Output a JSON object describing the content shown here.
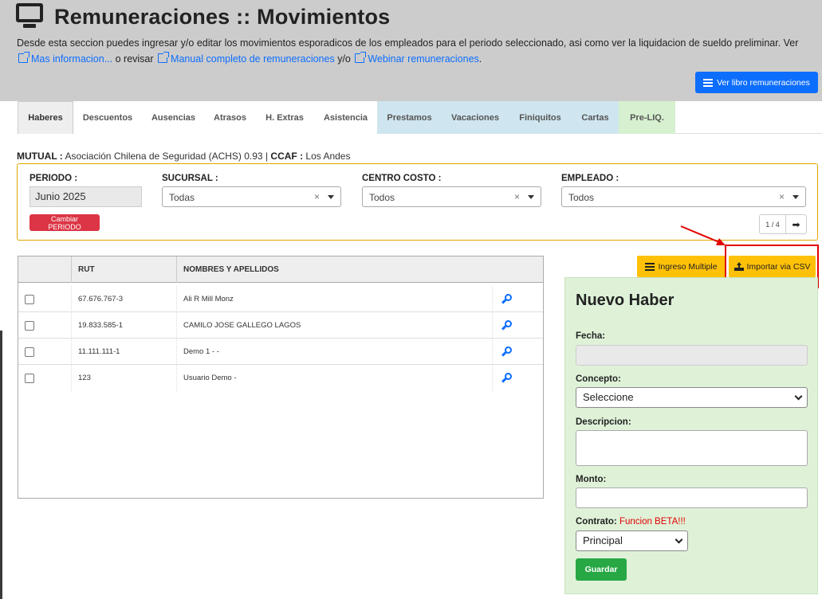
{
  "header": {
    "title": "Remuneraciones :: Movimientos",
    "desc_text_1": "Desde esta seccion puedes ingresar y/o editar los movimientos esporadicos de los empleados para el periodo seleccionado, asi como ver la liquidacion de sueldo preliminar. Ver",
    "link_mas_info": "Mas informacion...",
    "desc_text_2": "o revisar",
    "link_manual": "Manual completo de remuneraciones",
    "desc_text_3": "y/o",
    "link_webinar": "Webinar remuneraciones",
    "desc_text_4": ".",
    "btn_libro": "Ver libro remuneraciones"
  },
  "tabs": [
    {
      "label": "Haberes"
    },
    {
      "label": "Descuentos"
    },
    {
      "label": "Ausencias"
    },
    {
      "label": "Atrasos"
    },
    {
      "label": "H. Extras"
    },
    {
      "label": "Asistencia"
    },
    {
      "label": "Prestamos"
    },
    {
      "label": "Vacaciones"
    },
    {
      "label": "Finiquitos"
    },
    {
      "label": "Cartas"
    },
    {
      "label": "Pre-LIQ."
    }
  ],
  "info": {
    "mutual_label": "MUTUAL :",
    "mutual_value": "Asociación Chilena de Seguridad (ACHS) 0.93",
    "separator": "|",
    "ccaf_label": "CCAF :",
    "ccaf_value": "Los Andes"
  },
  "filters": {
    "periodo_label": "PERIODO :",
    "periodo_value": "Junio 2025",
    "sucursal_label": "SUCURSAL :",
    "sucursal_value": "Todas",
    "centro_label": "CENTRO COSTO :",
    "centro_value": "Todos",
    "empleado_label": "EMPLEADO :",
    "empleado_value": "Todos",
    "clear_symbol": "×",
    "btn_cambiar": "Cambiar PERIODO",
    "pager_count": "1 / 4",
    "pager_next": "➡"
  },
  "table": {
    "col_rut": "RUT",
    "col_nombres": "NOMBRES Y APELLIDOS",
    "rows": [
      {
        "rut": "67.676.767-3",
        "nombre": "Ali R Mill Monz"
      },
      {
        "rut": "19.833.585-1",
        "nombre": "CAMILO JOSE GALLEGO LAGOS"
      },
      {
        "rut": "11.111.111-1",
        "nombre": "Demo 1 - -"
      },
      {
        "rut": "123",
        "nombre": "Usuario Demo -"
      }
    ]
  },
  "actions": {
    "btn_ingreso_multiple": "Ingreso Multiple",
    "btn_importar_csv": "Importar via CSV"
  },
  "form": {
    "title": "Nuevo Haber",
    "fecha_label": "Fecha:",
    "concepto_label": "Concepto:",
    "concepto_value": "Seleccione",
    "descripcion_label": "Descripcion:",
    "monto_label": "Monto:",
    "contrato_label": "Contrato:",
    "contrato_beta": "Funcion BETA!!!",
    "contrato_value": "Principal",
    "btn_guardar": "Guardar"
  },
  "colors": {
    "primary": "#0d6efd",
    "danger": "#dc3545",
    "warning": "#ffc107",
    "success": "#28a745",
    "highlight": "#e00000"
  }
}
